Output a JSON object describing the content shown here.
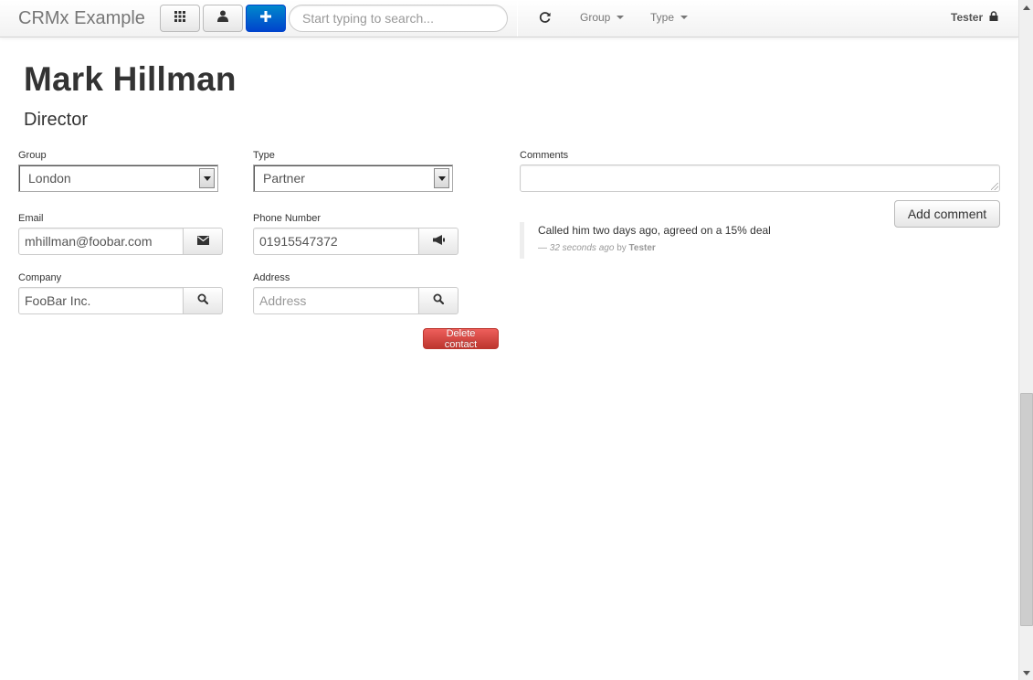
{
  "app": {
    "brand": "CRMx Example"
  },
  "navbar": {
    "search_placeholder": "Start typing to search...",
    "group_menu": "Group",
    "type_menu": "Type",
    "user": "Tester",
    "icons": {
      "grid": "grid-icon",
      "person": "user-icon",
      "add": "plus-icon",
      "refresh": "refresh-icon",
      "lock": "lock-icon"
    }
  },
  "contact": {
    "name": "Mark Hillman",
    "title": "Director",
    "fields": {
      "group": {
        "label": "Group",
        "value": "London"
      },
      "type": {
        "label": "Type",
        "value": "Partner"
      },
      "email": {
        "label": "Email",
        "value": "mhillman@foobar.com",
        "action_icon": "envelope-icon"
      },
      "phone": {
        "label": "Phone Number",
        "value": "01915547372",
        "action_icon": "megaphone-icon"
      },
      "company": {
        "label": "Company",
        "value": "FooBar Inc.",
        "action_icon": "search-icon"
      },
      "address": {
        "label": "Address",
        "value": "",
        "placeholder": "Address",
        "action_icon": "search-icon"
      }
    },
    "delete_label": "Delete contact"
  },
  "comments": {
    "label": "Comments",
    "add_label": "Add comment",
    "items": [
      {
        "text": "Called him two days ago, agreed on a 15% deal",
        "dash": "—",
        "time": "32 seconds ago",
        "by": "by",
        "author": "Tester"
      }
    ]
  },
  "colors": {
    "primary": "#0055cc",
    "danger": "#d9534f",
    "brand_text": "#777777"
  }
}
